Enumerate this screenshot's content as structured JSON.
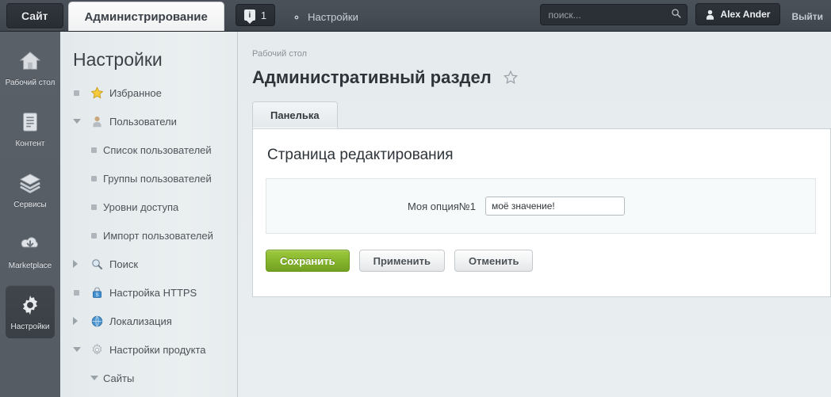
{
  "topbar": {
    "tab_site": "Сайт",
    "tab_admin": "Администрирование",
    "badge_icon": "info-bubble-icon",
    "badge_count": "1",
    "settings_label": "Настройки",
    "settings_icon": "gear-icon",
    "search_placeholder": "поиск...",
    "search_value": "",
    "search_icon": "search-icon",
    "user_name": "Alex Ander",
    "user_icon": "user-icon",
    "logout_label": "Выйти"
  },
  "rail": {
    "items": [
      {
        "label": "Рабочий стол",
        "icon": "home-icon",
        "active": false
      },
      {
        "label": "Контент",
        "icon": "document-icon",
        "active": false
      },
      {
        "label": "Сервисы",
        "icon": "layers-icon",
        "active": false
      },
      {
        "label": "Marketplace",
        "icon": "cloud-download-icon",
        "active": false
      },
      {
        "label": "Настройки",
        "icon": "gear-icon",
        "active": true
      }
    ]
  },
  "tree": {
    "title": "Настройки",
    "items": [
      {
        "label": "Избранное",
        "icon": "star-icon",
        "marker": "bullet",
        "level": 1
      },
      {
        "label": "Пользователи",
        "icon": "user-icon",
        "marker": "arrow-down",
        "level": 1
      },
      {
        "label": "Список пользователей",
        "icon": "",
        "marker": "bullet",
        "level": 2
      },
      {
        "label": "Группы пользователей",
        "icon": "",
        "marker": "bullet",
        "level": 2
      },
      {
        "label": "Уровни доступа",
        "icon": "",
        "marker": "bullet",
        "level": 2
      },
      {
        "label": "Импорт пользователей",
        "icon": "",
        "marker": "bullet",
        "level": 2
      },
      {
        "label": "Поиск",
        "icon": "magnifier-icon",
        "marker": "arrow-right",
        "level": 1
      },
      {
        "label": "Настройка HTTPS",
        "icon": "lock-icon",
        "marker": "bullet",
        "level": 1
      },
      {
        "label": "Локализация",
        "icon": "globe-icon",
        "marker": "arrow-right",
        "level": 1
      },
      {
        "label": "Настройки продукта",
        "icon": "gear-icon",
        "marker": "arrow-down",
        "level": 1
      },
      {
        "label": "Сайты",
        "icon": "",
        "marker": "arrow-down",
        "level": 2
      }
    ]
  },
  "main": {
    "breadcrumb": "Рабочий стол",
    "page_title": "Административный раздел",
    "favorite_icon": "star-outline-icon",
    "tab_label": "Панелька",
    "panel_heading": "Страница редактирования",
    "field_label": "Моя опция№1",
    "field_value": "моё значение!",
    "buttons": {
      "save": "Сохранить",
      "apply": "Применить",
      "cancel": "Отменить"
    }
  },
  "colors": {
    "topbar_bg": "#474d55",
    "rail_bg": "#565c64",
    "tree_bg": "#e7ecee",
    "content_bg": "#e9eef0",
    "primary_green": "#84b32c",
    "panel_white": "#ffffff"
  }
}
